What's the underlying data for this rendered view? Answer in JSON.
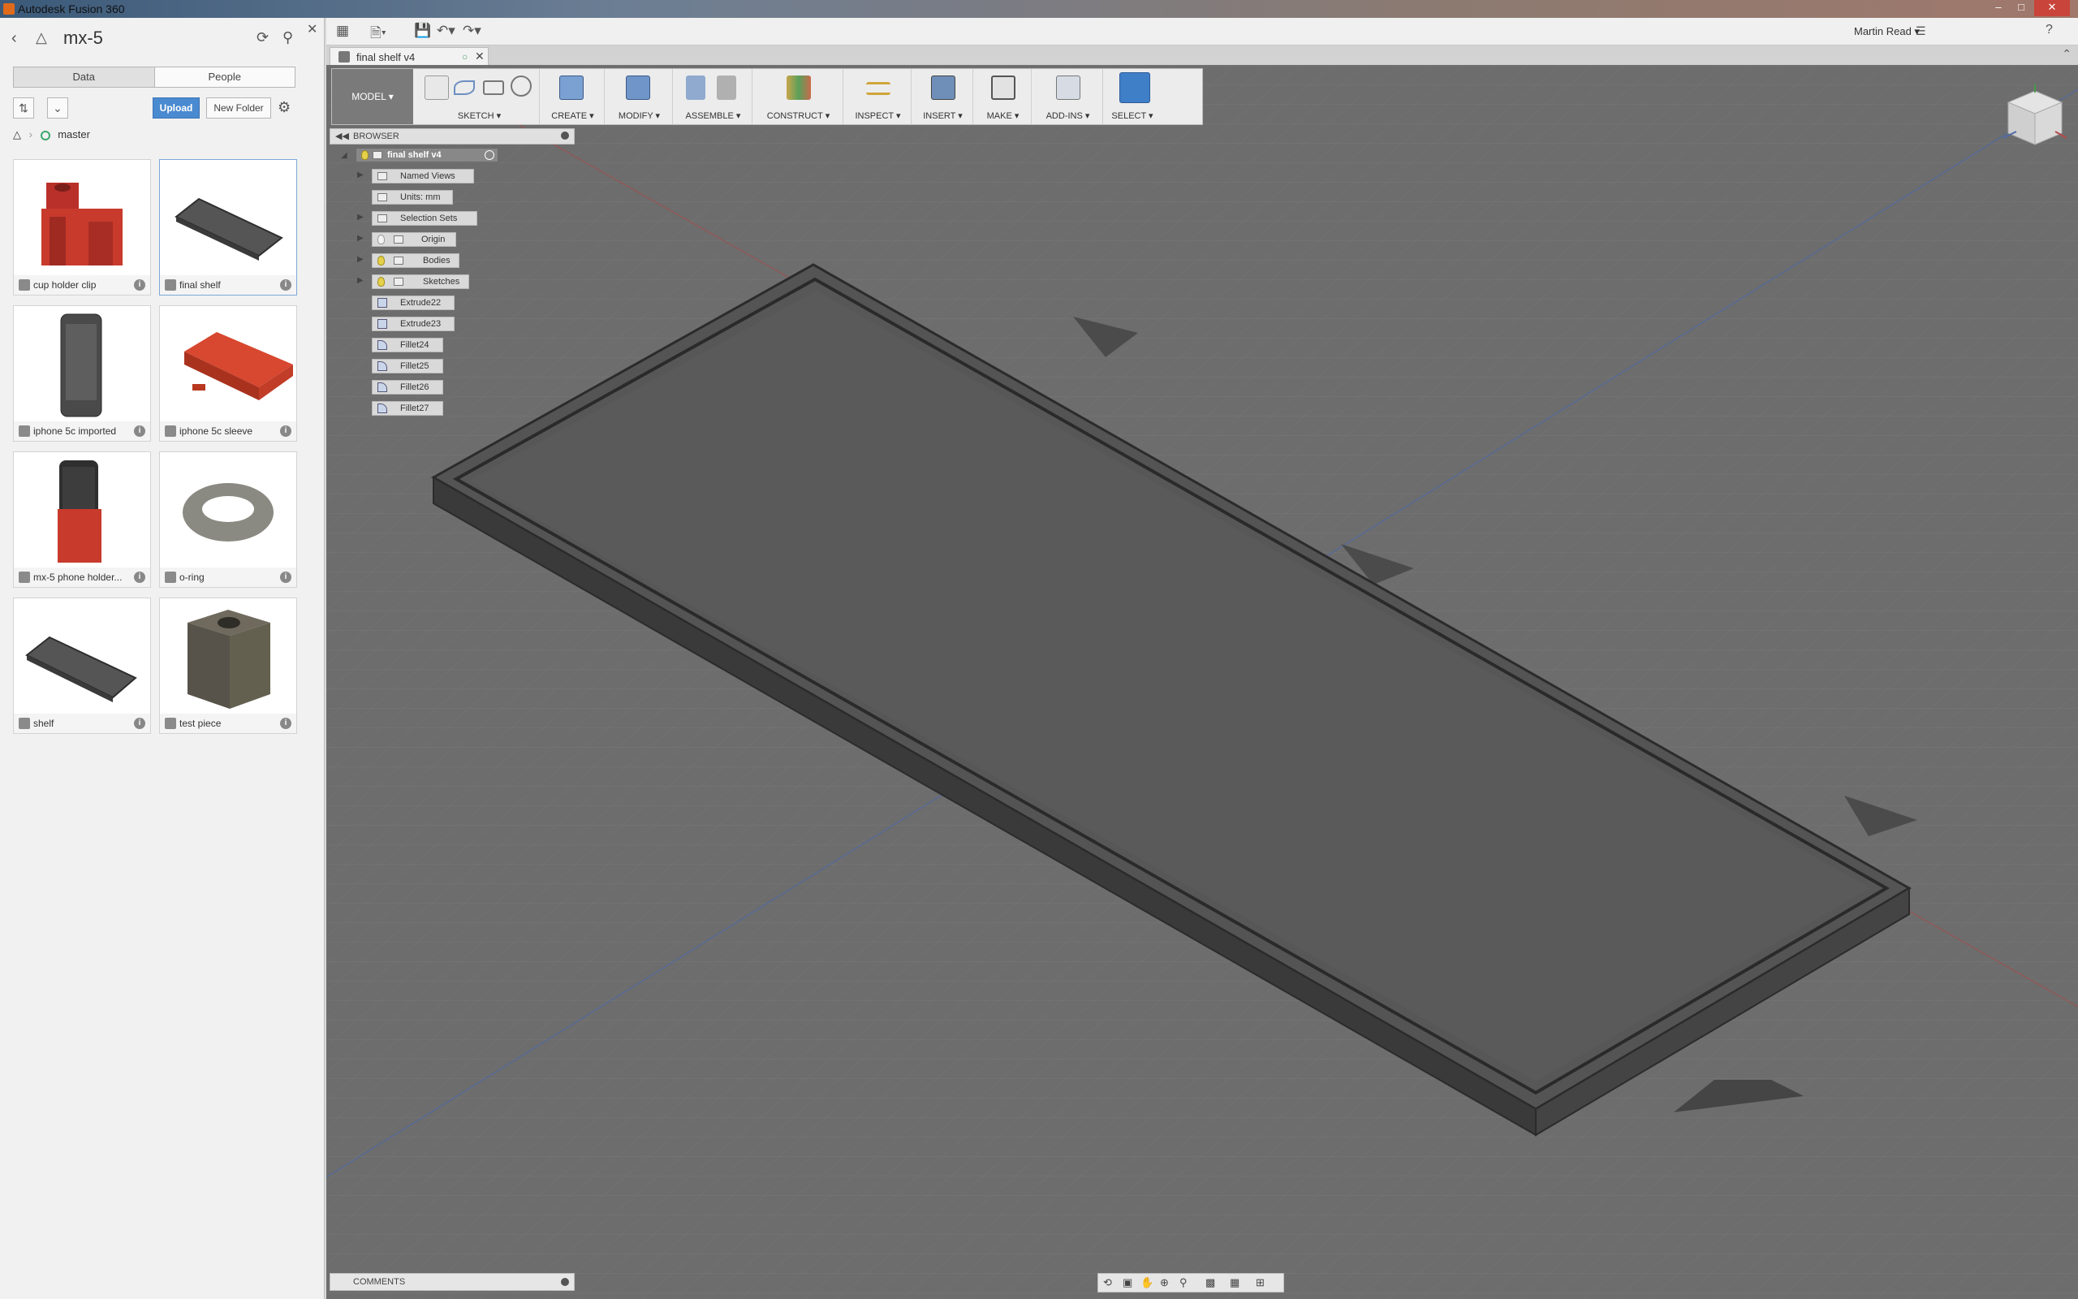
{
  "window": {
    "title": "Autodesk Fusion 360"
  },
  "data_panel": {
    "project_name": "mx-5",
    "tabs": [
      {
        "label": "Data",
        "active": true
      },
      {
        "label": "People",
        "active": false
      }
    ],
    "upload_label": "Upload",
    "new_folder_label": "New Folder",
    "breadcrumb_branch": "master",
    "files": [
      {
        "name": "cup holder clip",
        "thumb": "red-clip"
      },
      {
        "name": "final shelf",
        "thumb": "shelf",
        "selected": true
      },
      {
        "name": "iphone 5c imported",
        "thumb": "phone"
      },
      {
        "name": "iphone 5c sleeve",
        "thumb": "red-sleeve"
      },
      {
        "name": "mx-5 phone holder...",
        "thumb": "phone-holder"
      },
      {
        "name": "o-ring",
        "thumb": "ring"
      },
      {
        "name": "shelf",
        "thumb": "shelf"
      },
      {
        "name": "test piece",
        "thumb": "block"
      }
    ]
  },
  "appbar": {
    "user": "Martin Read ▾",
    "help": "?"
  },
  "document_tab": {
    "label": "final shelf v4"
  },
  "toolbar": {
    "workspace": "MODEL ▾",
    "groups": [
      {
        "label": "SKETCH ▾"
      },
      {
        "label": "CREATE ▾"
      },
      {
        "label": "MODIFY ▾"
      },
      {
        "label": "ASSEMBLE ▾"
      },
      {
        "label": "CONSTRUCT ▾"
      },
      {
        "label": "INSPECT ▾"
      },
      {
        "label": "INSERT ▾"
      },
      {
        "label": "MAKE ▾"
      },
      {
        "label": "ADD-INS ▾"
      },
      {
        "label": "SELECT ▾"
      }
    ]
  },
  "browser": {
    "title": "BROWSER",
    "root": "final shelf v4",
    "nodes": [
      {
        "label": "Named Views"
      },
      {
        "label": "Units: mm"
      },
      {
        "label": "Selection Sets"
      },
      {
        "label": "Origin"
      },
      {
        "label": "Bodies"
      },
      {
        "label": "Sketches"
      },
      {
        "label": "Extrude22"
      },
      {
        "label": "Extrude23"
      },
      {
        "label": "Fillet24"
      },
      {
        "label": "Fillet25"
      },
      {
        "label": "Fillet26"
      },
      {
        "label": "Fillet27"
      }
    ]
  },
  "comments": {
    "title": "COMMENTS"
  },
  "colors": {
    "accent": "#4a8ad0",
    "viewport_bg": "#6f6f6f",
    "model": "#4f4f4f",
    "thumb_red": "#c83a2c"
  }
}
